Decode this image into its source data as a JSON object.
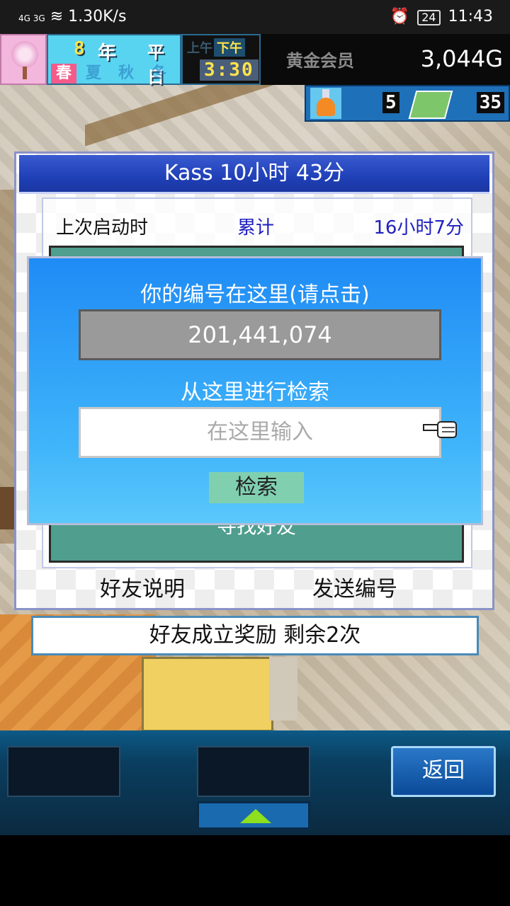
{
  "status_bar": {
    "network": "4G 3G",
    "speed": "1.30K/s",
    "battery": "24",
    "time": "11:43"
  },
  "hud": {
    "year_number": "8",
    "year_label": "年",
    "weekday": "平日",
    "seasons": [
      "春",
      "夏",
      "秋",
      "冬"
    ],
    "active_season": "春",
    "am_label": "上午",
    "pm_label": "下午",
    "clock": "3:30",
    "money_label": "黄金会员",
    "money": "3,044G",
    "research_points": "5",
    "tickets": "35"
  },
  "friend_panel": {
    "title": "Kass  10小时 43分",
    "last_launch_label": "上次启动时",
    "total_label": "累计",
    "total_value": "16小时7分",
    "find_friend_button": "寻找好友",
    "friend_help_button": "好友说明",
    "send_id_button": "发送编号",
    "reward_text": "好友成立奖励  剩余2次"
  },
  "search_dialog": {
    "id_label": "你的编号在这里(请点击)",
    "id_value": "201,441,074",
    "search_label": "从这里进行检索",
    "search_placeholder": "在这里输入",
    "search_button": "检索"
  },
  "bottom_bar": {
    "back_button": "返回"
  },
  "colors": {
    "dialog_blue": "#1f8bf5",
    "title_blue": "#2040b8",
    "friend_button_teal": "#4f9e8e",
    "search_button_green": "#80d0b0"
  }
}
